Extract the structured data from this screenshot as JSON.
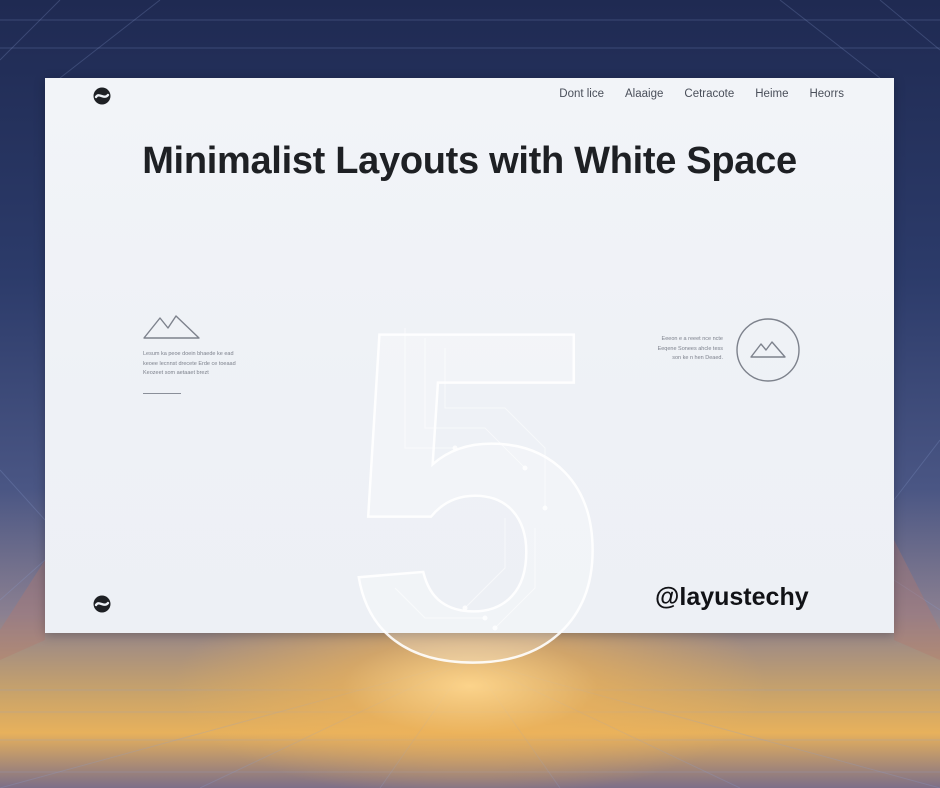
{
  "page": {
    "title": "Minimalist Layouts with White Space",
    "big_numeral": "5",
    "handle": "@layustechy"
  },
  "nav": {
    "items": [
      "Dont lice",
      "Alaaige",
      "Cetracote",
      "Heime",
      "Heorrs"
    ]
  },
  "left_block": {
    "icon": "mountain-icon",
    "lines": [
      "Lesum ka peoe doein bhaede ke ead",
      "keoee lecnnst drecete Erde ce toeaad",
      "Keozeet som aetaaet brezt"
    ]
  },
  "right_block": {
    "icon": "mountain-icon",
    "lines": [
      "Eeeon e a reeet nce ncte",
      "Eeqene Sonees ahcle tess",
      "son ke n hen Deaed."
    ]
  },
  "colors": {
    "panel": "#eef1f6",
    "title": "#1e2024",
    "accent_lines": "#8a8f99",
    "sky_top": "#1f2a52",
    "sky_glow": "#e7b15c"
  }
}
